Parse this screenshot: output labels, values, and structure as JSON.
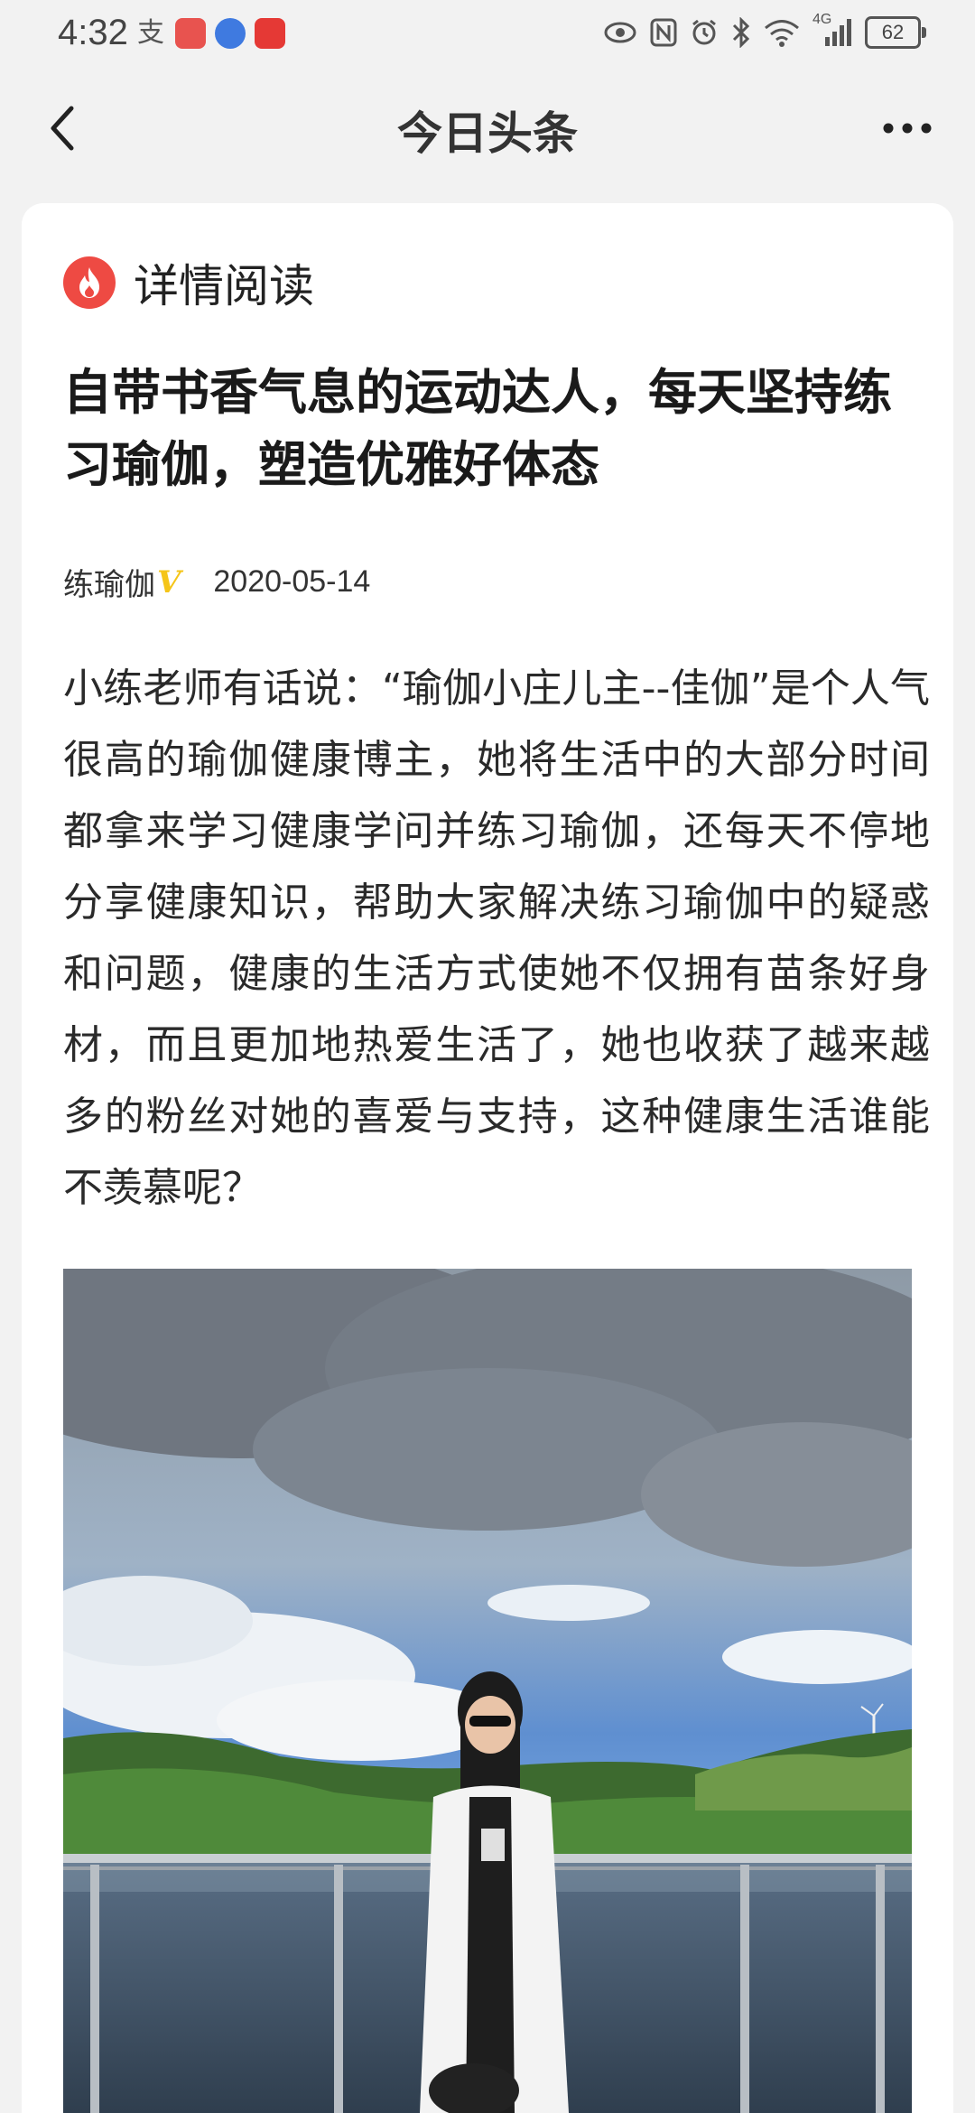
{
  "status_bar": {
    "time": "4:32",
    "battery": "62",
    "signal_label": "4G"
  },
  "header": {
    "title": "今日头条"
  },
  "section": {
    "label": "详情阅读"
  },
  "article": {
    "title": "自带书香气息的运动达人，每天坚持练习瑜伽，塑造优雅好体态",
    "author": "练瑜伽",
    "verified_mark": "V",
    "date": "2020-05-14",
    "body": "小练老师有话说：“瑜伽小庄儿主--佳伽”是个人气很高的瑜伽健康博主，她将生活中的大部分时间都拿来学习健康学问并练习瑜伽，还每天不停地分享健康知识，帮助大家解决练习瑜伽中的疑惑和问题，健康的生活方式使她不仅拥有苗条好身材，而且更加地热爱生活了，她也收获了越来越多的粉丝对她的喜爱与支持，这种健康生活谁能不羡慕呢？"
  },
  "icons": {
    "back": "back-arrow-icon",
    "more": "more-dots-icon",
    "fire": "fire-icon"
  },
  "colors": {
    "fire_badge": "#ee4a43",
    "verified": "#f5c518",
    "background": "#f2f2f2",
    "card": "#ffffff"
  }
}
